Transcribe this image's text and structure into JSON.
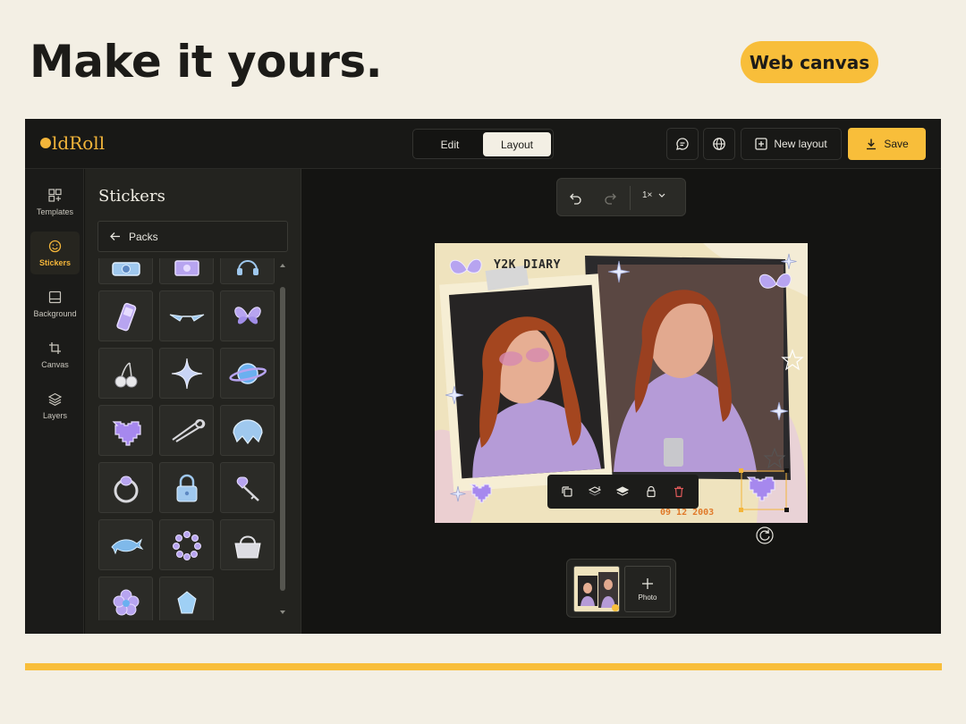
{
  "page": {
    "headline": "Make it yours.",
    "badge": "Web canvas"
  },
  "app": {
    "logo": "ldRoll",
    "mode_tabs": [
      {
        "label": "Edit",
        "active": false
      },
      {
        "label": "Layout",
        "active": true
      }
    ],
    "header_actions": {
      "new_layout": "New layout",
      "save": "Save"
    },
    "rail": [
      {
        "label": "Templates",
        "icon": "templates-icon",
        "active": false
      },
      {
        "label": "Stickers",
        "icon": "smiley-icon",
        "active": true
      },
      {
        "label": "Background",
        "icon": "background-icon",
        "active": false
      },
      {
        "label": "Canvas",
        "icon": "crop-icon",
        "active": false
      },
      {
        "label": "Layers",
        "icon": "layers-icon",
        "active": false
      }
    ],
    "panel": {
      "title": "Stickers",
      "back_label": "Packs",
      "stickers": [
        "camera-sticker",
        "flower-disc-sticker",
        "headphones-sticker",
        "flip-phone-sticker",
        "sunglasses-sticker",
        "butterfly-sticker",
        "cherries-sticker",
        "sparkle-sticker",
        "planet-sticker",
        "pixel-heart-sticker",
        "safety-pin-sticker",
        "hair-clip-sticker",
        "ring-sticker",
        "padlock-sticker",
        "heart-key-sticker",
        "dolphin-sticker",
        "bead-bracelet-sticker",
        "handbag-sticker",
        "flower-sticker",
        "gem-sticker"
      ]
    },
    "canvas_toolbar": {
      "zoom": "1×"
    },
    "collage": {
      "title": "Y2K DIARY",
      "date_stamp": "09 12 2003"
    },
    "thumbnail_bar": {
      "add_label": "Photo"
    },
    "colors": {
      "accent": "#f8be3a",
      "app_bg": "#141412",
      "page_bg": "#f3efe4"
    }
  }
}
